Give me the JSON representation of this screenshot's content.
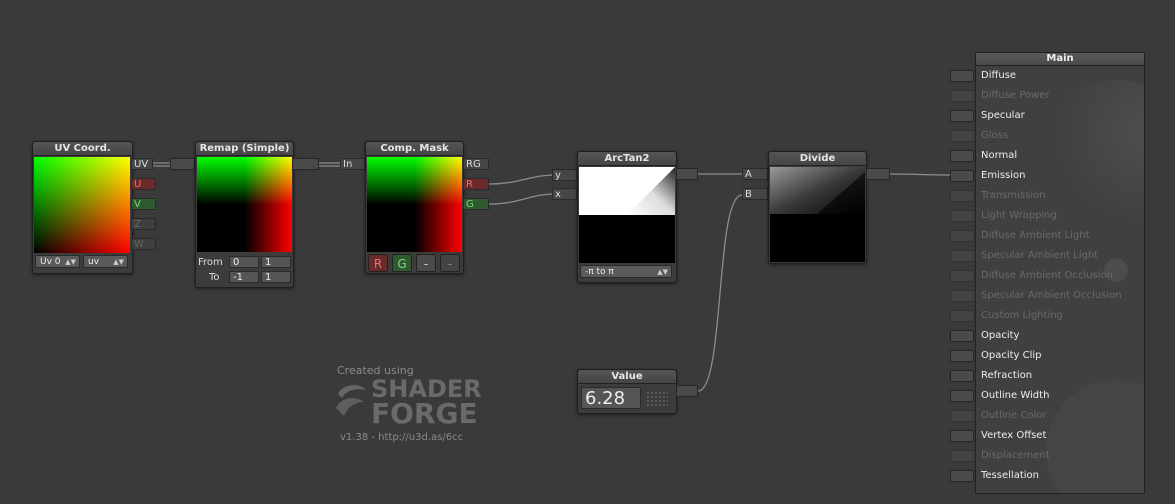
{
  "nodes": {
    "uv_coord": {
      "title": "UV Coord.",
      "outputs": [
        "UV",
        "U",
        "V",
        "Z",
        "W"
      ],
      "dropdown_channel": "Uv 0",
      "dropdown_mode": "uv"
    },
    "remap": {
      "title": "Remap (Simple)",
      "from_label": "From",
      "from_a": "0",
      "from_b": "1",
      "to_label": "To",
      "to_a": "-1",
      "to_b": "1"
    },
    "comp_mask": {
      "title": "Comp. Mask",
      "input": "In",
      "outputs": [
        "RG",
        "R",
        "G"
      ],
      "buttons": [
        "R",
        "G",
        "-",
        "-"
      ]
    },
    "arctan2": {
      "title": "ArcTan2",
      "inputs": [
        "y",
        "x"
      ],
      "dropdown": "-π to π"
    },
    "divide": {
      "title": "Divide",
      "inputs": [
        "A",
        "B"
      ]
    },
    "value": {
      "title": "Value",
      "value": "6.28"
    }
  },
  "main": {
    "title": "Main",
    "inputs": [
      {
        "label": "Diffuse",
        "enabled": true
      },
      {
        "label": "Diffuse Power",
        "enabled": false
      },
      {
        "label": "Specular",
        "enabled": true
      },
      {
        "label": "Gloss",
        "enabled": false
      },
      {
        "label": "Normal",
        "enabled": true
      },
      {
        "label": "Emission",
        "enabled": true
      },
      {
        "label": "Transmission",
        "enabled": false
      },
      {
        "label": "Light Wrapping",
        "enabled": false
      },
      {
        "label": "Diffuse Ambient Light",
        "enabled": false
      },
      {
        "label": "Specular Ambient Light",
        "enabled": false
      },
      {
        "label": "Diffuse Ambient Occlusion",
        "enabled": false
      },
      {
        "label": "Specular Ambient Occlusion",
        "enabled": false
      },
      {
        "label": "Custom Lighting",
        "enabled": false
      },
      {
        "label": "Opacity",
        "enabled": true
      },
      {
        "label": "Opacity Clip",
        "enabled": true
      },
      {
        "label": "Refraction",
        "enabled": true
      },
      {
        "label": "Outline Width",
        "enabled": true
      },
      {
        "label": "Outline Color",
        "enabled": false
      },
      {
        "label": "Vertex Offset",
        "enabled": true
      },
      {
        "label": "Displacement",
        "enabled": false
      },
      {
        "label": "Tessellation",
        "enabled": true
      }
    ]
  },
  "watermark": {
    "created_using": "Created using",
    "logo_line1": "SHADER",
    "logo_line2": "FORGE",
    "version": "v1.38 - http://u3d.as/6cc"
  },
  "colors": {
    "background": "#3a3a3a",
    "port_red": "#6b2a2a",
    "port_green": "#2f5a2f",
    "wire": "#8a8a8a"
  }
}
